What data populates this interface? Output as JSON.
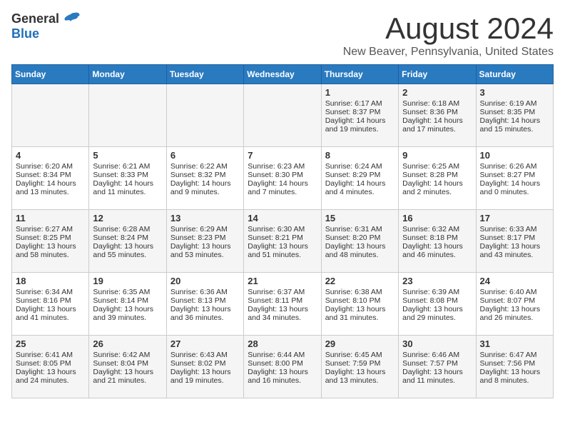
{
  "header": {
    "logo_general": "General",
    "logo_blue": "Blue",
    "month_year": "August 2024",
    "location": "New Beaver, Pennsylvania, United States"
  },
  "days_of_week": [
    "Sunday",
    "Monday",
    "Tuesday",
    "Wednesday",
    "Thursday",
    "Friday",
    "Saturday"
  ],
  "weeks": [
    [
      {
        "day": "",
        "content": ""
      },
      {
        "day": "",
        "content": ""
      },
      {
        "day": "",
        "content": ""
      },
      {
        "day": "",
        "content": ""
      },
      {
        "day": "1",
        "content": "Sunrise: 6:17 AM\nSunset: 8:37 PM\nDaylight: 14 hours\nand 19 minutes."
      },
      {
        "day": "2",
        "content": "Sunrise: 6:18 AM\nSunset: 8:36 PM\nDaylight: 14 hours\nand 17 minutes."
      },
      {
        "day": "3",
        "content": "Sunrise: 6:19 AM\nSunset: 8:35 PM\nDaylight: 14 hours\nand 15 minutes."
      }
    ],
    [
      {
        "day": "4",
        "content": "Sunrise: 6:20 AM\nSunset: 8:34 PM\nDaylight: 14 hours\nand 13 minutes."
      },
      {
        "day": "5",
        "content": "Sunrise: 6:21 AM\nSunset: 8:33 PM\nDaylight: 14 hours\nand 11 minutes."
      },
      {
        "day": "6",
        "content": "Sunrise: 6:22 AM\nSunset: 8:32 PM\nDaylight: 14 hours\nand 9 minutes."
      },
      {
        "day": "7",
        "content": "Sunrise: 6:23 AM\nSunset: 8:30 PM\nDaylight: 14 hours\nand 7 minutes."
      },
      {
        "day": "8",
        "content": "Sunrise: 6:24 AM\nSunset: 8:29 PM\nDaylight: 14 hours\nand 4 minutes."
      },
      {
        "day": "9",
        "content": "Sunrise: 6:25 AM\nSunset: 8:28 PM\nDaylight: 14 hours\nand 2 minutes."
      },
      {
        "day": "10",
        "content": "Sunrise: 6:26 AM\nSunset: 8:27 PM\nDaylight: 14 hours\nand 0 minutes."
      }
    ],
    [
      {
        "day": "11",
        "content": "Sunrise: 6:27 AM\nSunset: 8:25 PM\nDaylight: 13 hours\nand 58 minutes."
      },
      {
        "day": "12",
        "content": "Sunrise: 6:28 AM\nSunset: 8:24 PM\nDaylight: 13 hours\nand 55 minutes."
      },
      {
        "day": "13",
        "content": "Sunrise: 6:29 AM\nSunset: 8:23 PM\nDaylight: 13 hours\nand 53 minutes."
      },
      {
        "day": "14",
        "content": "Sunrise: 6:30 AM\nSunset: 8:21 PM\nDaylight: 13 hours\nand 51 minutes."
      },
      {
        "day": "15",
        "content": "Sunrise: 6:31 AM\nSunset: 8:20 PM\nDaylight: 13 hours\nand 48 minutes."
      },
      {
        "day": "16",
        "content": "Sunrise: 6:32 AM\nSunset: 8:18 PM\nDaylight: 13 hours\nand 46 minutes."
      },
      {
        "day": "17",
        "content": "Sunrise: 6:33 AM\nSunset: 8:17 PM\nDaylight: 13 hours\nand 43 minutes."
      }
    ],
    [
      {
        "day": "18",
        "content": "Sunrise: 6:34 AM\nSunset: 8:16 PM\nDaylight: 13 hours\nand 41 minutes."
      },
      {
        "day": "19",
        "content": "Sunrise: 6:35 AM\nSunset: 8:14 PM\nDaylight: 13 hours\nand 39 minutes."
      },
      {
        "day": "20",
        "content": "Sunrise: 6:36 AM\nSunset: 8:13 PM\nDaylight: 13 hours\nand 36 minutes."
      },
      {
        "day": "21",
        "content": "Sunrise: 6:37 AM\nSunset: 8:11 PM\nDaylight: 13 hours\nand 34 minutes."
      },
      {
        "day": "22",
        "content": "Sunrise: 6:38 AM\nSunset: 8:10 PM\nDaylight: 13 hours\nand 31 minutes."
      },
      {
        "day": "23",
        "content": "Sunrise: 6:39 AM\nSunset: 8:08 PM\nDaylight: 13 hours\nand 29 minutes."
      },
      {
        "day": "24",
        "content": "Sunrise: 6:40 AM\nSunset: 8:07 PM\nDaylight: 13 hours\nand 26 minutes."
      }
    ],
    [
      {
        "day": "25",
        "content": "Sunrise: 6:41 AM\nSunset: 8:05 PM\nDaylight: 13 hours\nand 24 minutes."
      },
      {
        "day": "26",
        "content": "Sunrise: 6:42 AM\nSunset: 8:04 PM\nDaylight: 13 hours\nand 21 minutes."
      },
      {
        "day": "27",
        "content": "Sunrise: 6:43 AM\nSunset: 8:02 PM\nDaylight: 13 hours\nand 19 minutes."
      },
      {
        "day": "28",
        "content": "Sunrise: 6:44 AM\nSunset: 8:00 PM\nDaylight: 13 hours\nand 16 minutes."
      },
      {
        "day": "29",
        "content": "Sunrise: 6:45 AM\nSunset: 7:59 PM\nDaylight: 13 hours\nand 13 minutes."
      },
      {
        "day": "30",
        "content": "Sunrise: 6:46 AM\nSunset: 7:57 PM\nDaylight: 13 hours\nand 11 minutes."
      },
      {
        "day": "31",
        "content": "Sunrise: 6:47 AM\nSunset: 7:56 PM\nDaylight: 13 hours\nand 8 minutes."
      }
    ]
  ]
}
